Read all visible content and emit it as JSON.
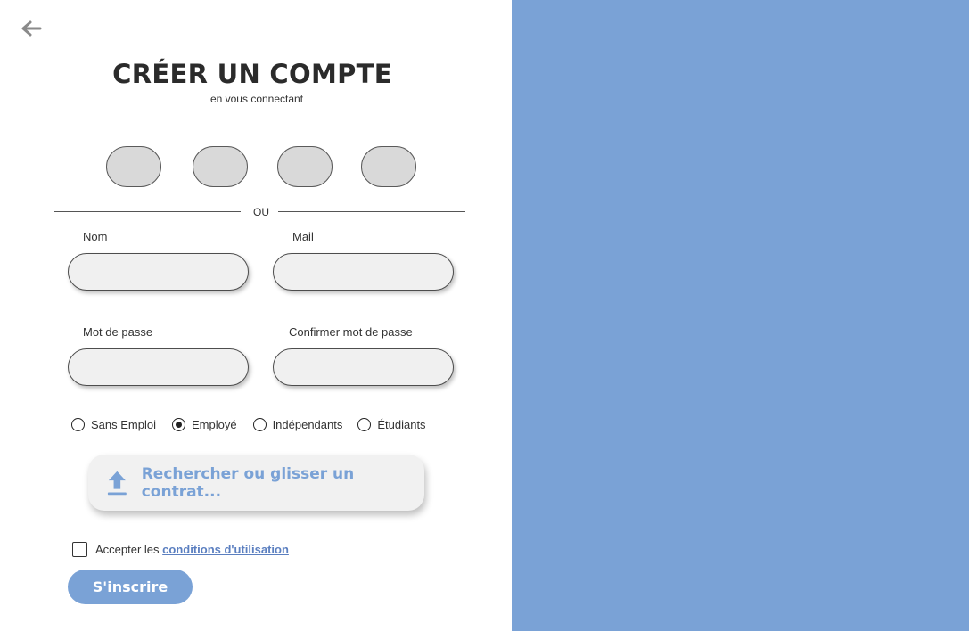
{
  "header": {
    "back_icon": "arrow-left-icon",
    "title": "CRÉER UN COMPTE",
    "subtitle": "en vous connectant"
  },
  "divider": {
    "label": "OU"
  },
  "form": {
    "name_label": "Nom",
    "mail_label": "Mail",
    "password_label": "Mot de passe",
    "confirm_password_label": "Confirmer mot de passe"
  },
  "status_options": [
    {
      "label": "Sans Emploi",
      "selected": false
    },
    {
      "label": "Employé",
      "selected": true
    },
    {
      "label": "Indépendants",
      "selected": false
    },
    {
      "label": "Étudiants",
      "selected": false
    }
  ],
  "upload": {
    "icon": "upload-icon",
    "label": "Rechercher ou glisser un contrat..."
  },
  "terms": {
    "prefix": "Accepter les ",
    "link": "conditions d'utilisation",
    "checked": false
  },
  "submit_label": "S'inscrire",
  "colors": {
    "accent": "#7aa2d6",
    "social_button": "#d9d9d9",
    "field_bg": "#f0f0f0",
    "title": "#2b2b2b"
  }
}
